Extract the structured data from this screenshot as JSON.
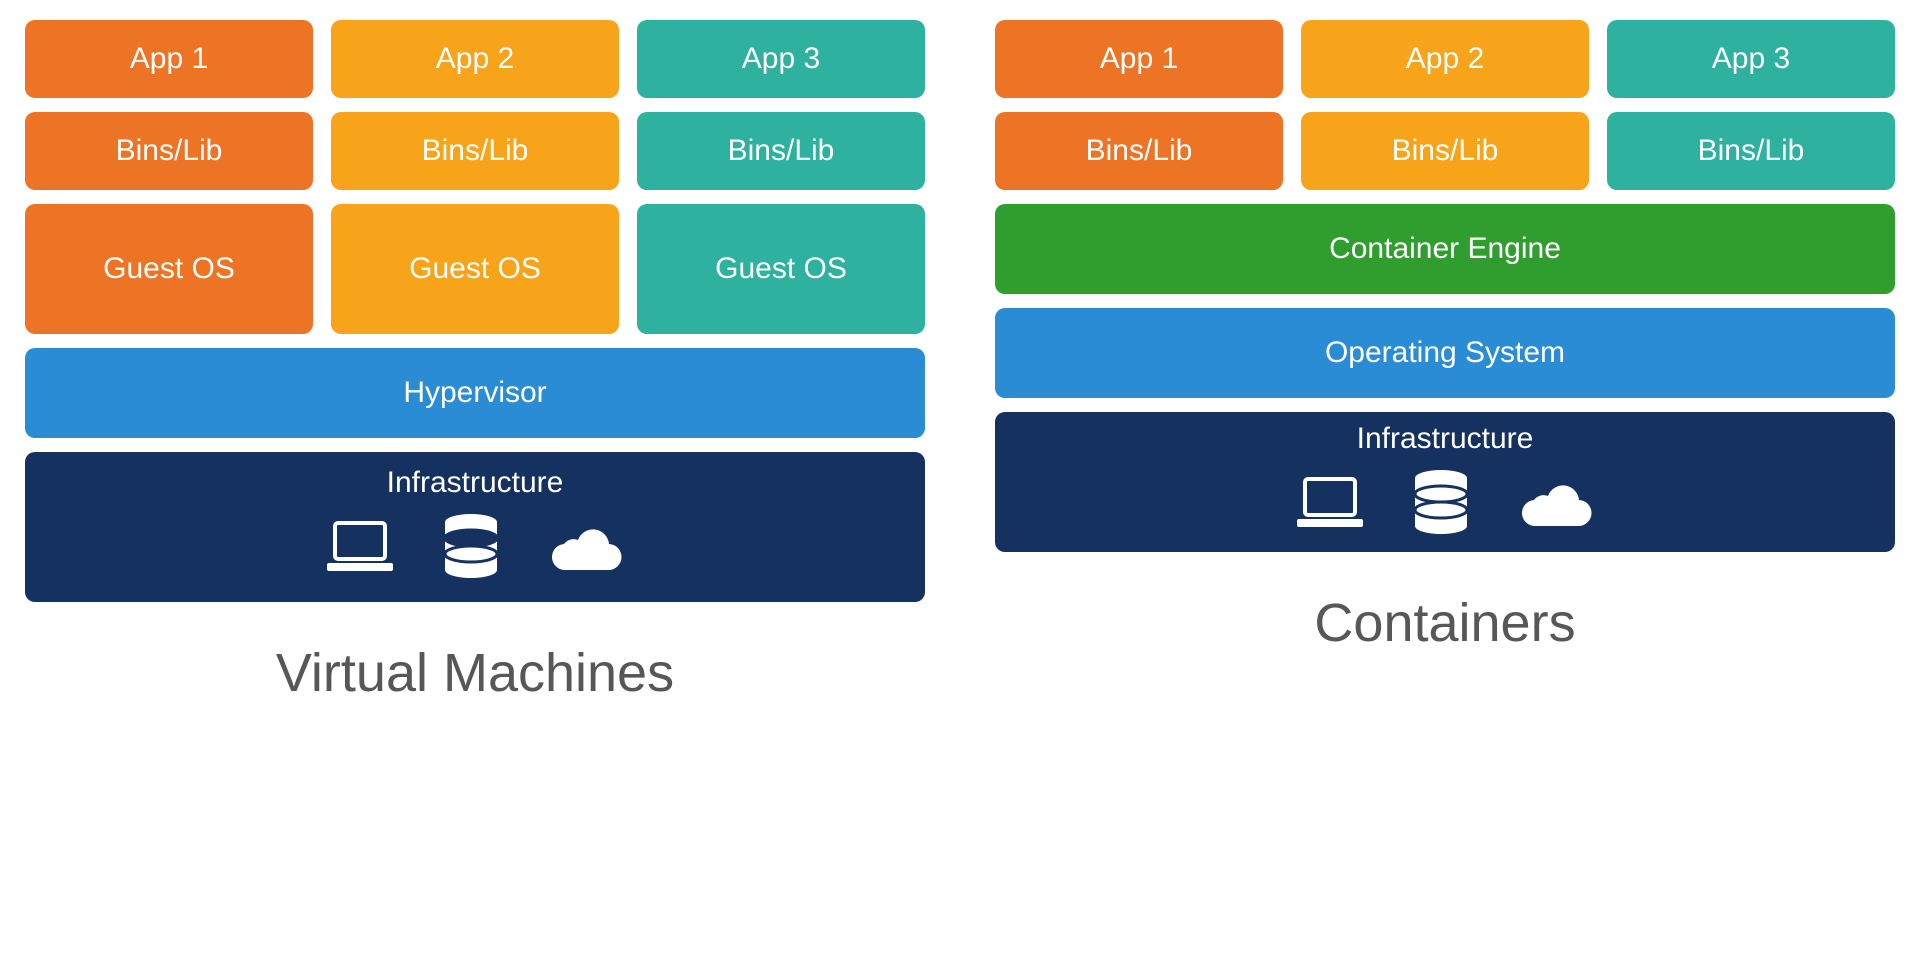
{
  "vm": {
    "title": "Virtual Machines",
    "apps": [
      "App 1",
      "App 2",
      "App 3"
    ],
    "bins": [
      "Bins/Lib",
      "Bins/Lib",
      "Bins/Lib"
    ],
    "guests": [
      "Guest OS",
      "Guest OS",
      "Guest OS"
    ],
    "hypervisor": "Hypervisor",
    "infrastructure": "Infrastructure"
  },
  "ct": {
    "title": "Containers",
    "apps": [
      "App 1",
      "App 2",
      "App 3"
    ],
    "bins": [
      "Bins/Lib",
      "Bins/Lib",
      "Bins/Lib"
    ],
    "engine": "Container Engine",
    "os": "Operating System",
    "infrastructure": "Infrastructure"
  },
  "colors": {
    "orange": "#ED7424",
    "amber": "#F7A41A",
    "teal": "#2EB19F",
    "green": "#2F9E2F",
    "blue": "#2B8CD6",
    "navy": "#15315F"
  },
  "icons": [
    "laptop-icon",
    "database-icon",
    "cloud-icon"
  ]
}
